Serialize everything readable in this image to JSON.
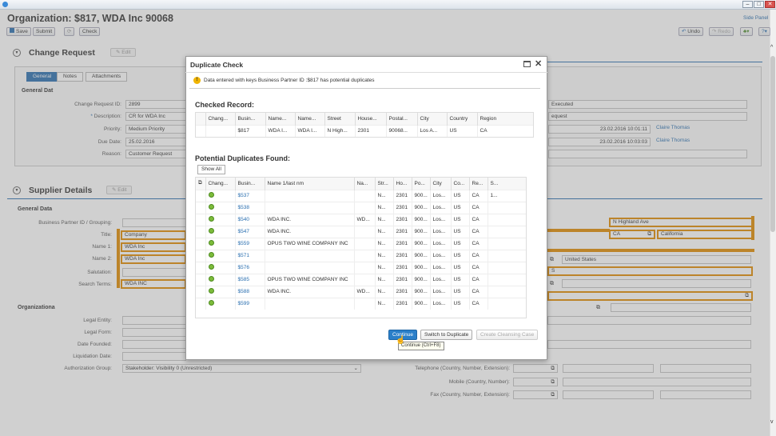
{
  "window": {
    "minimize": "‒",
    "maximize": "□",
    "close": "✕"
  },
  "page": {
    "title": "Organization: $817, WDA Inc 90068",
    "side_panel": "Side Panel"
  },
  "toolbar": {
    "save": "Save",
    "submit": "Submit",
    "check": "Check",
    "undo": "Undo",
    "redo": "Redo"
  },
  "change_request": {
    "heading": "Change Request",
    "edit": "Edit",
    "tabs": [
      "General",
      "Notes",
      "Attachments"
    ],
    "group_title": "General Dat",
    "fields": [
      {
        "label": "Change Request ID:",
        "value": "2899"
      },
      {
        "label": "Description:",
        "value": "CR for WDA Inc",
        "required": true
      },
      {
        "label": "Priority:",
        "value": "Medium Priority"
      },
      {
        "label": "Due Date:",
        "value": "25.02.2016"
      },
      {
        "label": "Reason:",
        "value": "Customer  Request"
      }
    ],
    "right_values": [
      "Executed",
      "equest"
    ],
    "timestamps": [
      {
        "date": "23.02.2016 10:01:11",
        "user": "Claire Thomas"
      },
      {
        "date": "23.02.2016 10:03:03",
        "user": "Claire Thomas"
      }
    ]
  },
  "supplier_details": {
    "heading": "Supplier Details",
    "edit": "Edit",
    "general_data_title": "General Data",
    "fields": [
      {
        "label": "Business Partner ID / Grouping:",
        "value": ""
      },
      {
        "label": "Title:",
        "value": "Company"
      },
      {
        "label": "Name 1:",
        "value": "WDA Inc"
      },
      {
        "label": "Name 2:",
        "value": "WDA Inc"
      },
      {
        "label": "Salutation:",
        "value": ""
      },
      {
        "label": "Search Terms:",
        "value": "WDA INC"
      }
    ],
    "address": {
      "street": "N Highland Ave",
      "region_code": "CA",
      "region_name": "California",
      "country": "United States",
      "country_code": "S"
    },
    "org_title": "Organizationa",
    "org_fields": [
      "Legal Entity:",
      "Legal Form:",
      "Date Founded:",
      "Liquidation Date:"
    ],
    "authorization_group": {
      "label": "Authorization Group:",
      "value": "Stakeholder: Visibility 0 (Unrestricted)"
    },
    "communication": [
      "Telephone (Country, Number, Extension):",
      "Mobile (Country, Number):",
      "Fax (Country, Number, Extension):"
    ]
  },
  "dialog": {
    "title": "Duplicate Check",
    "warning": "Data entered with keys Business Partner ID :$817 has potential duplicates",
    "checked_title": "Checked Record:",
    "checked_headers": [
      "Chang...",
      "Busin...",
      "Name...",
      "Name...",
      "Street",
      "House...",
      "Postal...",
      "City",
      "Country",
      "Region"
    ],
    "checked_row": [
      "",
      "$817",
      "WDA I...",
      "WDA I...",
      "N High...",
      "2301",
      "90068...",
      "Los A...",
      "US",
      "CA"
    ],
    "duplicates_title": "Potential Duplicates Found:",
    "show_all": "Show All",
    "dup_headers": [
      "Chang...",
      "Busin...",
      "Name 1/last nm",
      "Na...",
      "Str...",
      "Ho...",
      "Po...",
      "City",
      "Co...",
      "Re...",
      "S..."
    ],
    "dup_rows": [
      [
        "$537",
        "",
        "",
        "N...",
        "2301",
        "900...",
        "Los...",
        "US",
        "CA",
        "1..."
      ],
      [
        "$538",
        "",
        "",
        "N...",
        "2301",
        "900...",
        "Los...",
        "US",
        "CA",
        ""
      ],
      [
        "$540",
        "WDA INC.",
        "WD...",
        "N...",
        "2301",
        "900...",
        "Los...",
        "US",
        "CA",
        ""
      ],
      [
        "$547",
        "WDA INC.",
        "",
        "N...",
        "2301",
        "900...",
        "Los...",
        "US",
        "CA",
        ""
      ],
      [
        "$559",
        "OPUS TWO WINE COMPANY INC",
        "",
        "N...",
        "2301",
        "900...",
        "Los...",
        "US",
        "CA",
        ""
      ],
      [
        "$571",
        "",
        "",
        "N...",
        "2301",
        "900...",
        "Los...",
        "US",
        "CA",
        ""
      ],
      [
        "$576",
        "",
        "",
        "N...",
        "2301",
        "900...",
        "Los...",
        "US",
        "CA",
        ""
      ],
      [
        "$585",
        "OPUS TWO WINE COMPANY INC",
        "",
        "N...",
        "2301",
        "900...",
        "Los...",
        "US",
        "CA",
        ""
      ],
      [
        "$588",
        "WDA INC.",
        "WD...",
        "N...",
        "2301",
        "900...",
        "Los...",
        "US",
        "CA",
        ""
      ],
      [
        "$599",
        "",
        "",
        "N...",
        "2301",
        "900...",
        "Los...",
        "US",
        "CA",
        ""
      ]
    ],
    "buttons": {
      "continue": "Continue",
      "switch": "Switch to Duplicate",
      "cleansing": "Create Cleansing Case"
    },
    "tooltip": "Continue (Ctrl+F8)"
  }
}
